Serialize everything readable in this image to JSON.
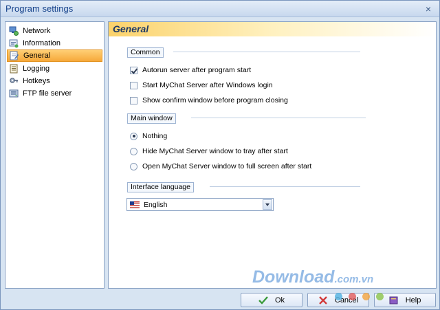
{
  "window": {
    "title": "Program settings",
    "close_glyph": "×"
  },
  "sidebar": {
    "items": [
      {
        "label": "Network",
        "icon": "network-icon",
        "selected": false
      },
      {
        "label": "Information",
        "icon": "information-icon",
        "selected": false
      },
      {
        "label": "General",
        "icon": "general-icon",
        "selected": true
      },
      {
        "label": "Logging",
        "icon": "logging-icon",
        "selected": false
      },
      {
        "label": "Hotkeys",
        "icon": "hotkeys-icon",
        "selected": false
      },
      {
        "label": "FTP file server",
        "icon": "ftp-icon",
        "selected": false
      }
    ]
  },
  "main": {
    "heading": "General",
    "common": {
      "label": "Common",
      "options": [
        {
          "label": "Autorun server after program start",
          "checked": true
        },
        {
          "label": "Start MyChat Server after Windows login",
          "checked": false
        },
        {
          "label": "Show confirm window before program closing",
          "checked": false
        }
      ]
    },
    "main_window": {
      "label": "Main window",
      "options": [
        {
          "label": "Nothing",
          "selected": true
        },
        {
          "label": "Hide MyChat Server window to tray after start",
          "selected": false
        },
        {
          "label": "Open MyChat Server window to full screen after start",
          "selected": false
        }
      ]
    },
    "interface_language": {
      "label": "Interface language",
      "value": "English",
      "flag_icon": "us-flag-icon"
    }
  },
  "buttons": {
    "ok": "Ok",
    "cancel": "Cancel",
    "help": "Help"
  },
  "watermark": {
    "text": "Download",
    "suffix": ".com.vn"
  },
  "colors": {
    "accent": "#f6a83a",
    "title_text": "#15428b",
    "watermark": "#4f8fd6",
    "dots": [
      "#4fb0e0",
      "#e15b5b",
      "#f2a33c",
      "#8bc34a"
    ]
  }
}
